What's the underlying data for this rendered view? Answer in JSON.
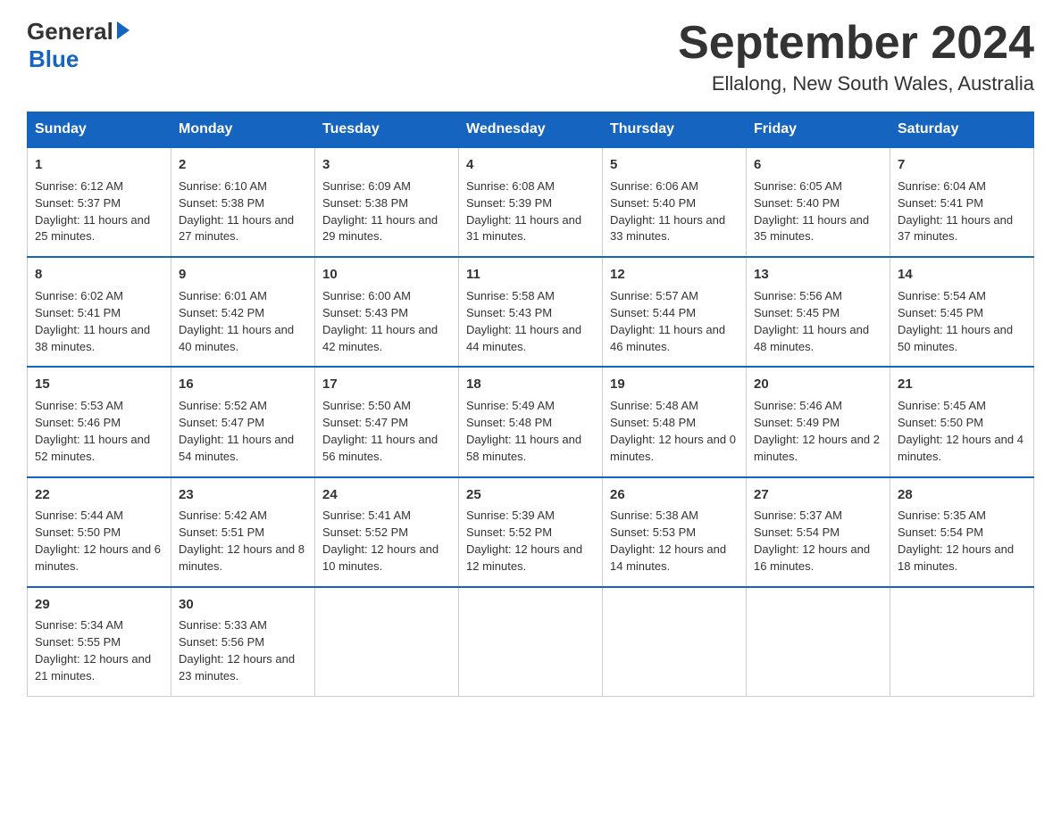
{
  "header": {
    "logo_general": "General",
    "logo_blue": "Blue",
    "month_title": "September 2024",
    "location": "Ellalong, New South Wales, Australia"
  },
  "days_of_week": [
    "Sunday",
    "Monday",
    "Tuesday",
    "Wednesday",
    "Thursday",
    "Friday",
    "Saturday"
  ],
  "weeks": [
    [
      {
        "day": "1",
        "sunrise": "6:12 AM",
        "sunset": "5:37 PM",
        "daylight": "11 hours and 25 minutes."
      },
      {
        "day": "2",
        "sunrise": "6:10 AM",
        "sunset": "5:38 PM",
        "daylight": "11 hours and 27 minutes."
      },
      {
        "day": "3",
        "sunrise": "6:09 AM",
        "sunset": "5:38 PM",
        "daylight": "11 hours and 29 minutes."
      },
      {
        "day": "4",
        "sunrise": "6:08 AM",
        "sunset": "5:39 PM",
        "daylight": "11 hours and 31 minutes."
      },
      {
        "day": "5",
        "sunrise": "6:06 AM",
        "sunset": "5:40 PM",
        "daylight": "11 hours and 33 minutes."
      },
      {
        "day": "6",
        "sunrise": "6:05 AM",
        "sunset": "5:40 PM",
        "daylight": "11 hours and 35 minutes."
      },
      {
        "day": "7",
        "sunrise": "6:04 AM",
        "sunset": "5:41 PM",
        "daylight": "11 hours and 37 minutes."
      }
    ],
    [
      {
        "day": "8",
        "sunrise": "6:02 AM",
        "sunset": "5:41 PM",
        "daylight": "11 hours and 38 minutes."
      },
      {
        "day": "9",
        "sunrise": "6:01 AM",
        "sunset": "5:42 PM",
        "daylight": "11 hours and 40 minutes."
      },
      {
        "day": "10",
        "sunrise": "6:00 AM",
        "sunset": "5:43 PM",
        "daylight": "11 hours and 42 minutes."
      },
      {
        "day": "11",
        "sunrise": "5:58 AM",
        "sunset": "5:43 PM",
        "daylight": "11 hours and 44 minutes."
      },
      {
        "day": "12",
        "sunrise": "5:57 AM",
        "sunset": "5:44 PM",
        "daylight": "11 hours and 46 minutes."
      },
      {
        "day": "13",
        "sunrise": "5:56 AM",
        "sunset": "5:45 PM",
        "daylight": "11 hours and 48 minutes."
      },
      {
        "day": "14",
        "sunrise": "5:54 AM",
        "sunset": "5:45 PM",
        "daylight": "11 hours and 50 minutes."
      }
    ],
    [
      {
        "day": "15",
        "sunrise": "5:53 AM",
        "sunset": "5:46 PM",
        "daylight": "11 hours and 52 minutes."
      },
      {
        "day": "16",
        "sunrise": "5:52 AM",
        "sunset": "5:47 PM",
        "daylight": "11 hours and 54 minutes."
      },
      {
        "day": "17",
        "sunrise": "5:50 AM",
        "sunset": "5:47 PM",
        "daylight": "11 hours and 56 minutes."
      },
      {
        "day": "18",
        "sunrise": "5:49 AM",
        "sunset": "5:48 PM",
        "daylight": "11 hours and 58 minutes."
      },
      {
        "day": "19",
        "sunrise": "5:48 AM",
        "sunset": "5:48 PM",
        "daylight": "12 hours and 0 minutes."
      },
      {
        "day": "20",
        "sunrise": "5:46 AM",
        "sunset": "5:49 PM",
        "daylight": "12 hours and 2 minutes."
      },
      {
        "day": "21",
        "sunrise": "5:45 AM",
        "sunset": "5:50 PM",
        "daylight": "12 hours and 4 minutes."
      }
    ],
    [
      {
        "day": "22",
        "sunrise": "5:44 AM",
        "sunset": "5:50 PM",
        "daylight": "12 hours and 6 minutes."
      },
      {
        "day": "23",
        "sunrise": "5:42 AM",
        "sunset": "5:51 PM",
        "daylight": "12 hours and 8 minutes."
      },
      {
        "day": "24",
        "sunrise": "5:41 AM",
        "sunset": "5:52 PM",
        "daylight": "12 hours and 10 minutes."
      },
      {
        "day": "25",
        "sunrise": "5:39 AM",
        "sunset": "5:52 PM",
        "daylight": "12 hours and 12 minutes."
      },
      {
        "day": "26",
        "sunrise": "5:38 AM",
        "sunset": "5:53 PM",
        "daylight": "12 hours and 14 minutes."
      },
      {
        "day": "27",
        "sunrise": "5:37 AM",
        "sunset": "5:54 PM",
        "daylight": "12 hours and 16 minutes."
      },
      {
        "day": "28",
        "sunrise": "5:35 AM",
        "sunset": "5:54 PM",
        "daylight": "12 hours and 18 minutes."
      }
    ],
    [
      {
        "day": "29",
        "sunrise": "5:34 AM",
        "sunset": "5:55 PM",
        "daylight": "12 hours and 21 minutes."
      },
      {
        "day": "30",
        "sunrise": "5:33 AM",
        "sunset": "5:56 PM",
        "daylight": "12 hours and 23 minutes."
      },
      null,
      null,
      null,
      null,
      null
    ]
  ],
  "labels": {
    "sunrise": "Sunrise: ",
    "sunset": "Sunset: ",
    "daylight": "Daylight: "
  }
}
